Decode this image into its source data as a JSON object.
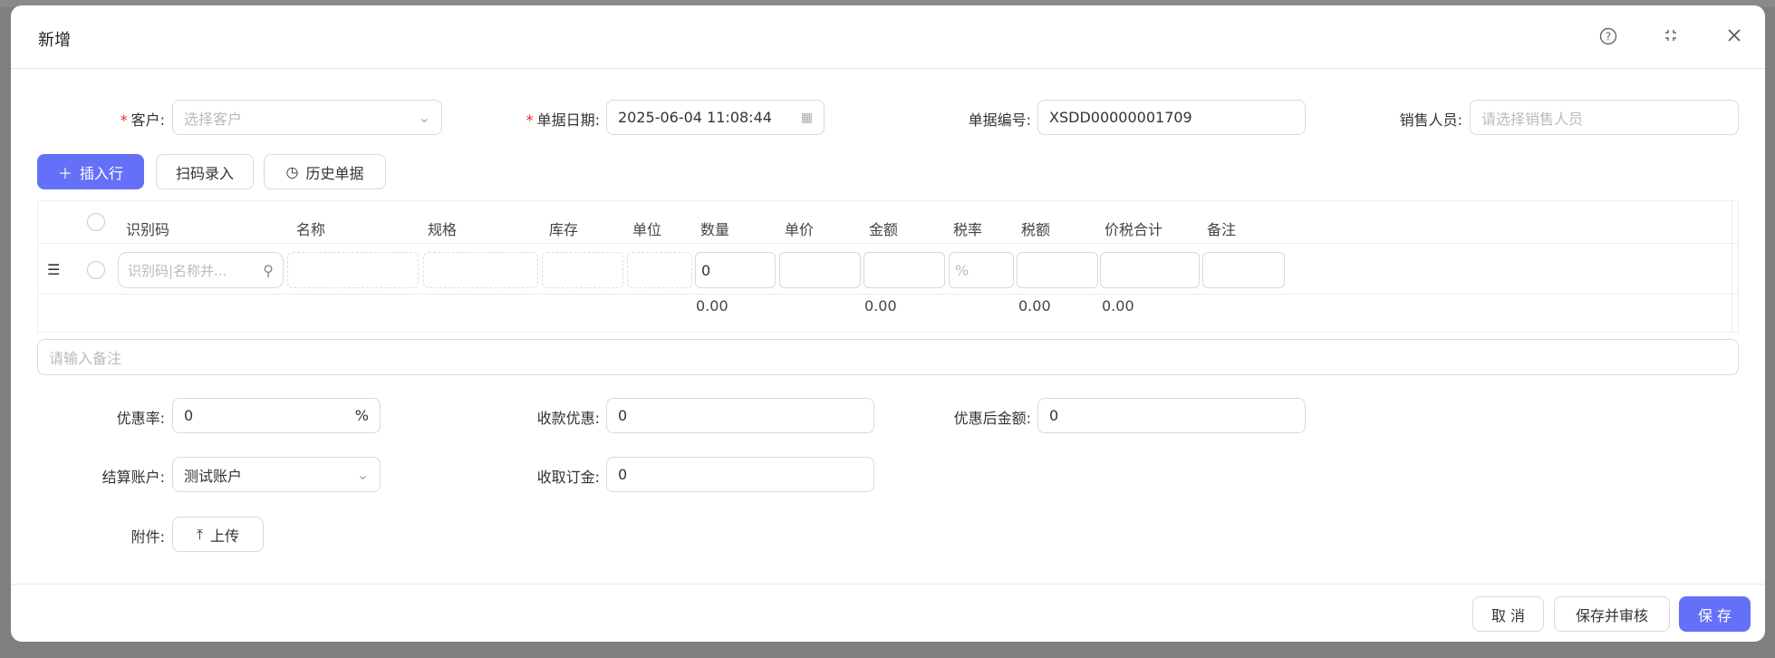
{
  "dialog": {
    "title": "新增",
    "icons": [
      "help-icon",
      "fullscreen-icon",
      "close-icon"
    ]
  },
  "form": {
    "customer": {
      "label": "客户:",
      "placeholder": "选择客户"
    },
    "doc_date": {
      "label": "单据日期:",
      "value": "2025-06-04 11:08:44"
    },
    "doc_no": {
      "label": "单据编号:",
      "value": "XSDD00000001709"
    },
    "salesperson": {
      "label": "销售人员:",
      "placeholder": "请选择销售人员"
    }
  },
  "toolbar": {
    "insert_row": "插入行",
    "scan_entry": "扫码录入",
    "history": "历史单据"
  },
  "table": {
    "headers": [
      "识别码",
      "名称",
      "规格",
      "库存",
      "单位",
      "数量",
      "单价",
      "金额",
      "税率",
      "税额",
      "价税合计",
      "备注"
    ],
    "row": {
      "code_placeholder": "识别码|名称并...",
      "quantity": "0",
      "tax_rate_suffix": "%"
    },
    "summary": {
      "quantity": "0.00",
      "amount": "0.00",
      "tax": "0.00",
      "total": "0.00"
    }
  },
  "remark": {
    "placeholder": "请输入备注"
  },
  "discount": {
    "rate": {
      "label": "优惠率:",
      "value": "0",
      "suffix": "%"
    },
    "payment_discount": {
      "label": "收款优惠:",
      "value": "0"
    },
    "after_amount": {
      "label": "优惠后金额:",
      "value": "0"
    },
    "account": {
      "label": "结算账户:",
      "value": "测试账户"
    },
    "deposit": {
      "label": "收取订金:",
      "value": "0"
    },
    "attachment": {
      "label": "附件:",
      "upload": "上传"
    }
  },
  "footer": {
    "cancel": "取 消",
    "save_audit": "保存并审核",
    "save": "保 存"
  },
  "colors": {
    "primary": "#6570f8",
    "required": "#f5222d"
  }
}
